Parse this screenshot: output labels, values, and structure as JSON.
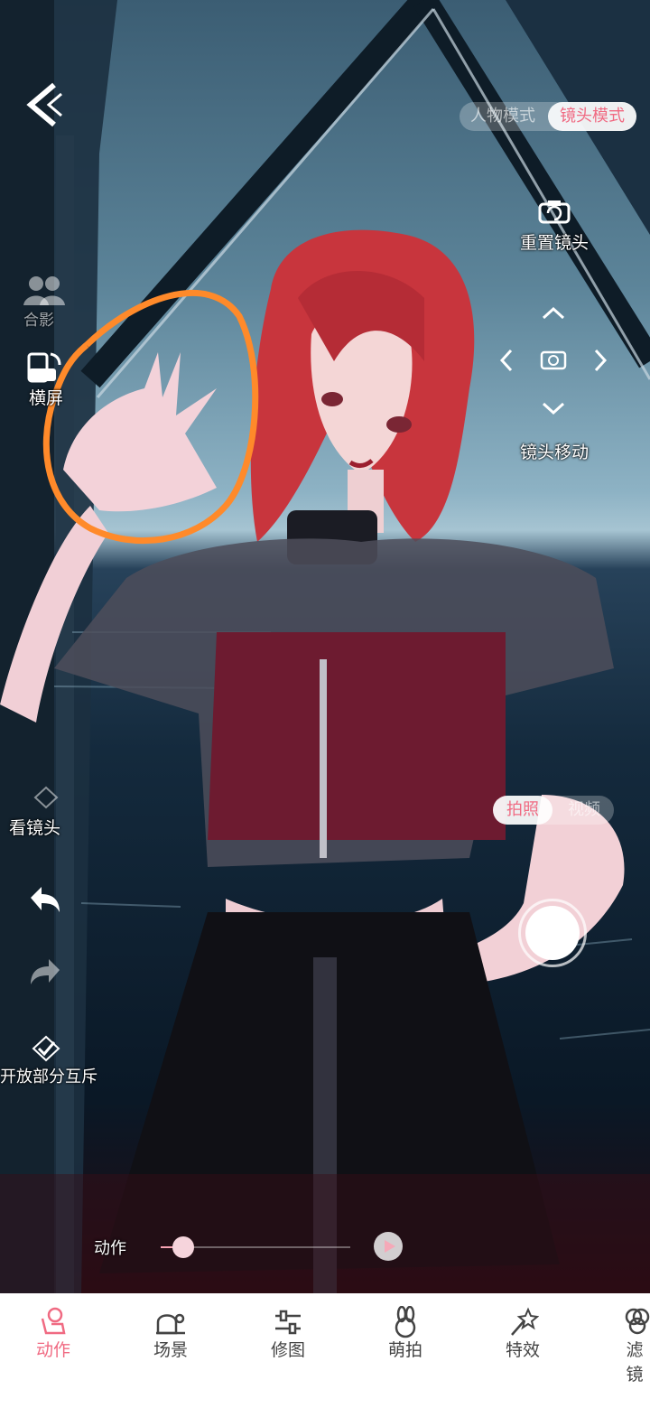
{
  "top": {
    "back_icon": "chevron-left-icon",
    "mode_toggle": {
      "options": [
        "人物模式",
        "镜头模式"
      ],
      "selected": "镜头模式"
    }
  },
  "left_tools": {
    "group_photo": "合影",
    "landscape": "横屏",
    "look_camera": "看镜头",
    "undo_icon": "undo-icon",
    "redo_icon": "redo-icon",
    "open_interaction": "开放部分互斥"
  },
  "right_tools": {
    "reset_camera": "重置镜头",
    "camera_move": "镜头移动"
  },
  "capture": {
    "options": [
      "拍照",
      "视频"
    ],
    "selected": "拍照"
  },
  "action_bar": {
    "label": "动作",
    "progress": 0.12
  },
  "tabs": [
    {
      "label": "动作",
      "icon": "pose-icon",
      "active": true
    },
    {
      "label": "场景",
      "icon": "scene-icon",
      "active": false
    },
    {
      "label": "修图",
      "icon": "adjust-icon",
      "active": false
    },
    {
      "label": "萌拍",
      "icon": "bunny-icon",
      "active": false
    },
    {
      "label": "特效",
      "icon": "magic-wand-icon",
      "active": false
    },
    {
      "label": "滤镜",
      "icon": "filter-icon",
      "active": false
    }
  ],
  "colors": {
    "accent": "#f06a82",
    "annotation": "#ff8a2a"
  }
}
